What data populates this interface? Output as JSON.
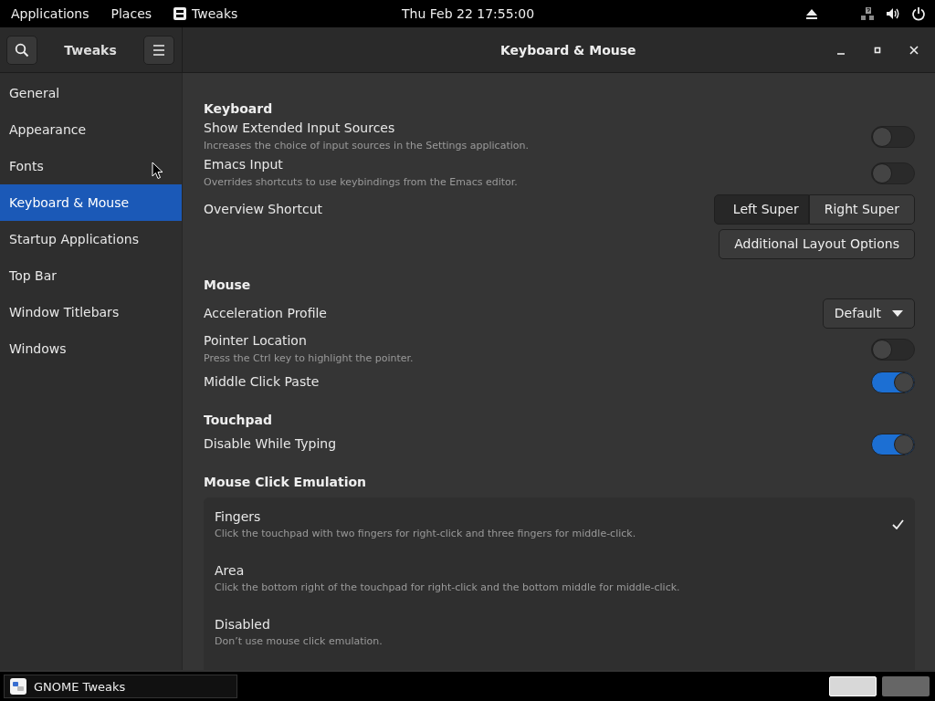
{
  "top_bar": {
    "menus": [
      "Applications",
      "Places"
    ],
    "app": "Tweaks",
    "clock": "Thu Feb 22  17:55:00"
  },
  "header": {
    "app_title": "Tweaks",
    "title": "Keyboard & Mouse"
  },
  "sidebar": {
    "items": [
      {
        "label": "General",
        "selected": false
      },
      {
        "label": "Appearance",
        "selected": false
      },
      {
        "label": "Fonts",
        "selected": false
      },
      {
        "label": "Keyboard & Mouse",
        "selected": true
      },
      {
        "label": "Startup Applications",
        "selected": false
      },
      {
        "label": "Top Bar",
        "selected": false
      },
      {
        "label": "Window Titlebars",
        "selected": false
      },
      {
        "label": "Windows",
        "selected": false
      }
    ]
  },
  "sections": [
    {
      "title": "Keyboard",
      "rows": [
        {
          "kind": "switch",
          "label": "Show Extended Input Sources",
          "description": "Increases the choice of input sources in the Settings application.",
          "on": false
        },
        {
          "kind": "switch",
          "label": "Emacs Input",
          "description": "Overrides shortcuts to use keybindings from the Emacs editor.",
          "on": false
        },
        {
          "kind": "segmented",
          "label": "Overview Shortcut",
          "options": [
            {
              "label": "Left Super",
              "selected": true
            },
            {
              "label": "Right Super",
              "selected": false
            }
          ]
        },
        {
          "kind": "button",
          "button": "Additional Layout Options"
        }
      ]
    },
    {
      "title": "Mouse",
      "rows": [
        {
          "kind": "dropdown",
          "label": "Acceleration Profile",
          "value": "Default"
        },
        {
          "kind": "switch",
          "label": "Pointer Location",
          "description": "Press the Ctrl key to highlight the pointer.",
          "on": false
        },
        {
          "kind": "switch",
          "label": "Middle Click Paste",
          "on": true
        }
      ]
    },
    {
      "title": "Touchpad",
      "rows": [
        {
          "kind": "switch",
          "label": "Disable While Typing",
          "on": true
        }
      ]
    },
    {
      "title": "Mouse Click Emulation",
      "rows": [
        {
          "kind": "choices",
          "options": [
            {
              "label": "Fingers",
              "description": "Click the touchpad with two fingers for right-click and three fingers for middle-click.",
              "selected": true
            },
            {
              "label": "Area",
              "description": "Click the bottom right of the touchpad for right-click and the bottom middle for middle-click.",
              "selected": false
            },
            {
              "label": "Disabled",
              "description": "Don’t use mouse click emulation.",
              "selected": false
            }
          ]
        }
      ]
    }
  ],
  "taskbar": {
    "window": "GNOME Tweaks",
    "workspaces": [
      {
        "selected": true
      },
      {
        "selected": false
      }
    ]
  }
}
